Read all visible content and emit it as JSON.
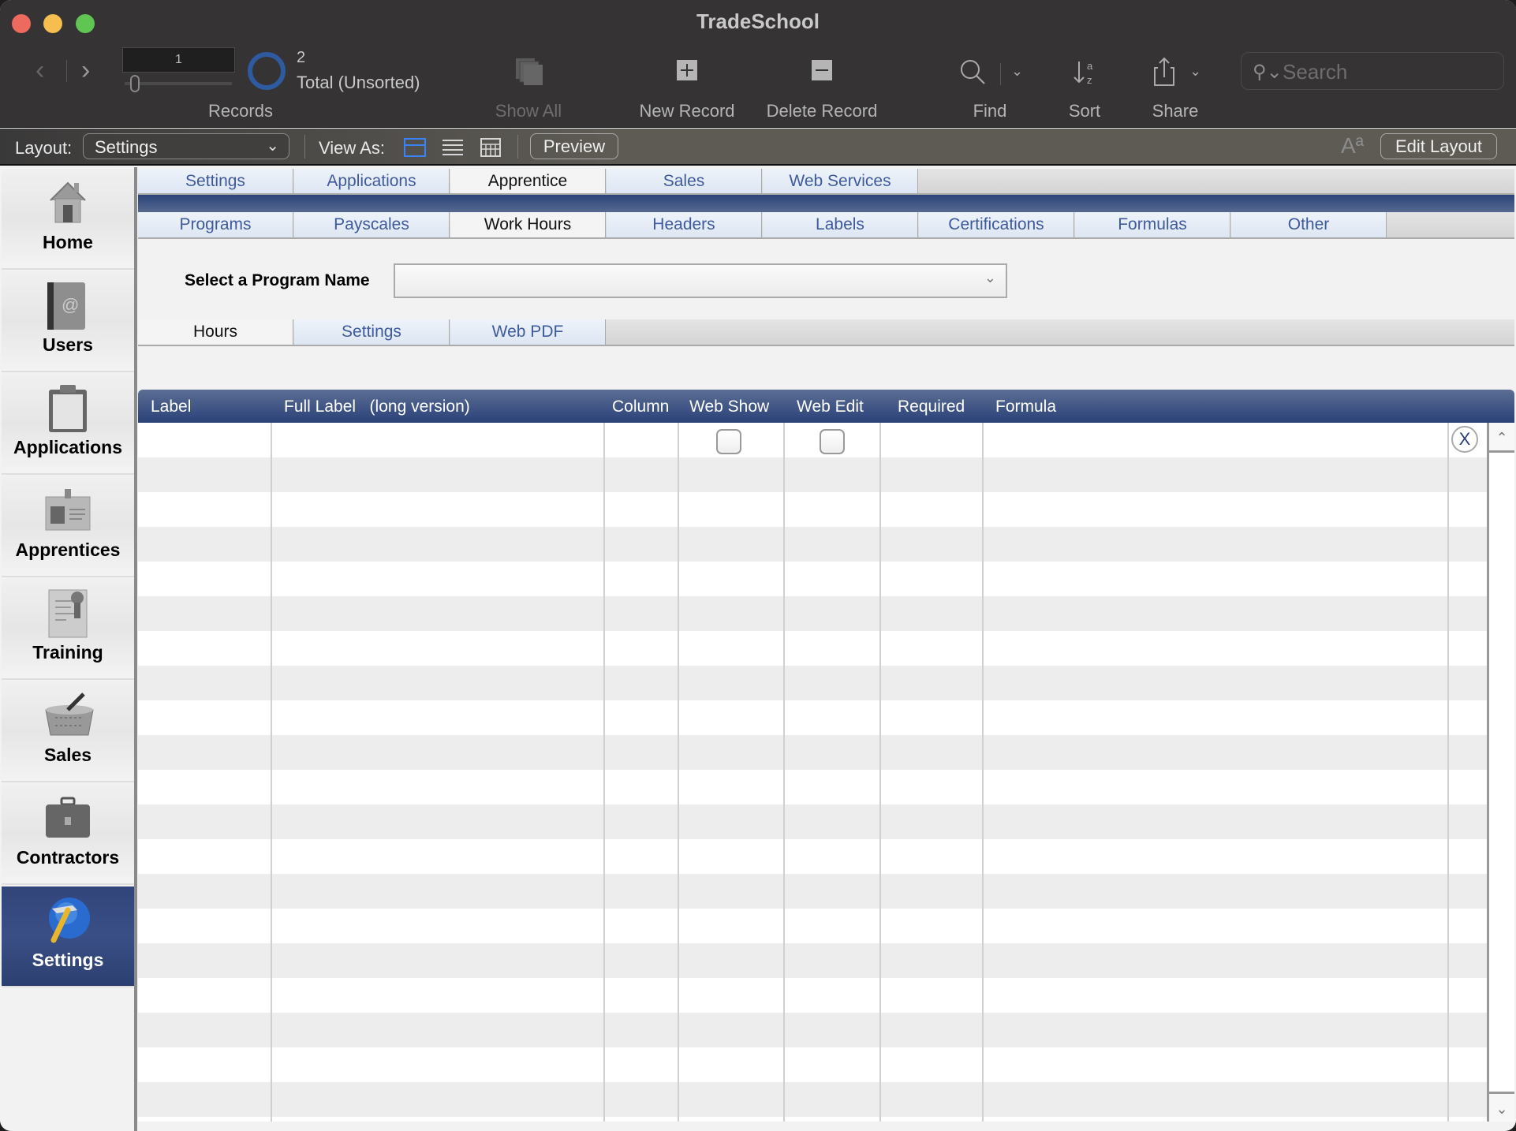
{
  "window": {
    "title": "TradeSchool"
  },
  "toolbar": {
    "record_current": "1",
    "record_count": "2",
    "record_total_label": "Total (Unsorted)",
    "records_label": "Records",
    "show_all_label": "Show All",
    "new_record_label": "New Record",
    "delete_record_label": "Delete Record",
    "find_label": "Find",
    "sort_label": "Sort",
    "share_label": "Share",
    "search_placeholder": "Search"
  },
  "layoutbar": {
    "layout_label": "Layout:",
    "layout_value": "Settings",
    "view_as_label": "View As:",
    "view_modes": [
      "form-view-icon",
      "list-view-icon",
      "table-view-icon"
    ],
    "active_view": "form",
    "preview_label": "Preview",
    "edit_layout_label": "Edit Layout",
    "font_size_glyph": "Aª"
  },
  "sidebar": {
    "items": [
      {
        "label": "Home",
        "icon": "house-icon"
      },
      {
        "label": "Users",
        "icon": "address-book-icon"
      },
      {
        "label": "Applications",
        "icon": "clipboard-icon"
      },
      {
        "label": "Apprentices",
        "icon": "id-badge-icon"
      },
      {
        "label": "Training",
        "icon": "certificate-icon"
      },
      {
        "label": "Sales",
        "icon": "basket-icon"
      },
      {
        "label": "Contractors",
        "icon": "briefcase-icon"
      },
      {
        "label": "Settings",
        "icon": "hammer-globe-icon",
        "active": true
      }
    ]
  },
  "tabs_primary": [
    {
      "label": "Settings"
    },
    {
      "label": "Applications"
    },
    {
      "label": "Apprentice",
      "active": true
    },
    {
      "label": "Sales"
    },
    {
      "label": "Web Services"
    }
  ],
  "tabs_secondary": [
    {
      "label": "Programs"
    },
    {
      "label": "Payscales"
    },
    {
      "label": "Work Hours",
      "active": true
    },
    {
      "label": "Headers"
    },
    {
      "label": "Labels"
    },
    {
      "label": "Certifications"
    },
    {
      "label": "Formulas"
    },
    {
      "label": "Other"
    }
  ],
  "program_select": {
    "label": "Select a Program Name",
    "value": ""
  },
  "tabs_tertiary": [
    {
      "label": "Hours",
      "active": true
    },
    {
      "label": "Settings"
    },
    {
      "label": "Web PDF"
    }
  ],
  "grid": {
    "headers": [
      "Label",
      "Full Label   (long version)",
      "Column",
      "Web Show",
      "Web Edit",
      "Required",
      "Formula"
    ],
    "rows": [
      {
        "label": "",
        "full_label": "",
        "column": "",
        "web_show": false,
        "web_edit": false,
        "required": "",
        "formula": ""
      }
    ],
    "delete_glyph": "X"
  }
}
